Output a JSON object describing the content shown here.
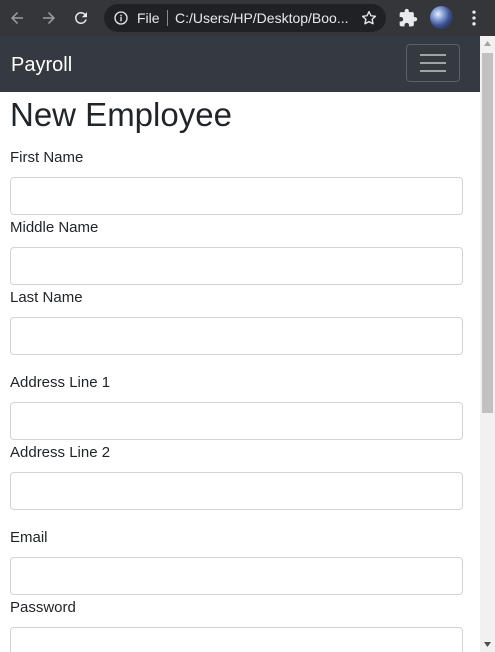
{
  "browser": {
    "omnibox_scheme": "File",
    "omnibox_url": "C:/Users/HP/Desktop/Boo..."
  },
  "navbar": {
    "brand": "Payroll"
  },
  "form": {
    "title": "New Employee",
    "fields": [
      {
        "label": "First Name",
        "value": ""
      },
      {
        "label": "Middle Name",
        "value": ""
      },
      {
        "label": "Last Name",
        "value": ""
      },
      {
        "label": "Address Line 1",
        "value": ""
      },
      {
        "label": "Address Line 2",
        "value": ""
      },
      {
        "label": "Email",
        "value": ""
      },
      {
        "label": "Password",
        "value": ""
      }
    ]
  },
  "colors": {
    "chrome_bg": "#35363a",
    "omnibox_bg": "#202124",
    "navbar_bg": "#343a40",
    "text": "#212529",
    "input_border": "#ced4da"
  },
  "icons": {
    "back": "arrow-left-icon",
    "forward": "arrow-right-icon",
    "reload": "reload-icon",
    "site_info": "info-icon",
    "bookmark": "star-icon",
    "extensions": "puzzle-icon",
    "profile": "avatar",
    "menu": "kebab-icon",
    "navbar_toggle": "hamburger-icon"
  }
}
